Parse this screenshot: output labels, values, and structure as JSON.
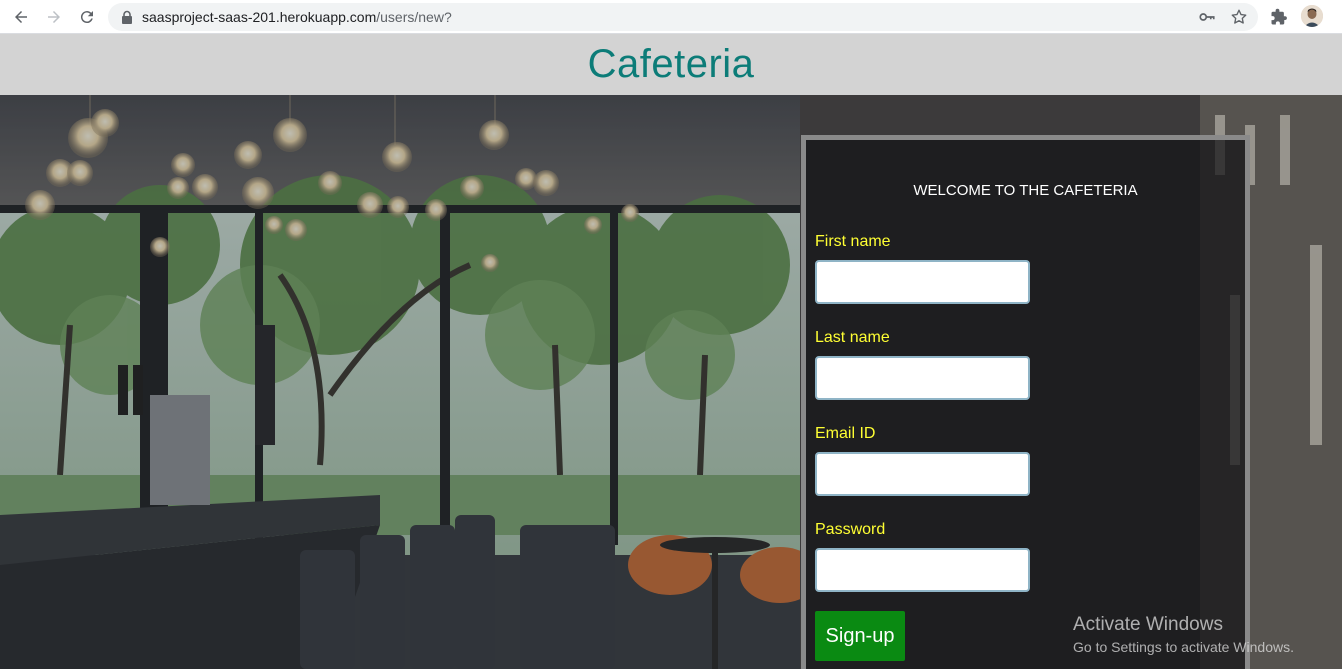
{
  "browser": {
    "url_host": "saasproject-saas-201.herokuapp.com",
    "url_path": "/users/new?",
    "icons": [
      "back-icon",
      "forward-icon",
      "reload-icon",
      "lock-icon",
      "key-icon",
      "star-icon",
      "puzzle-icon"
    ]
  },
  "header": {
    "title": "Cafeteria",
    "color": "#0c7c78"
  },
  "form": {
    "welcome": "WELCOME TO THE CAFETERIA",
    "fields": [
      {
        "label": "First name",
        "value": ""
      },
      {
        "label": "Last name",
        "value": ""
      },
      {
        "label": "Email ID",
        "value": ""
      },
      {
        "label": "Password",
        "value": ""
      }
    ],
    "submit_label": "Sign-up",
    "label_color": "#ffff33",
    "button_color": "#0a8a12"
  },
  "watermark": {
    "title": "Activate Windows",
    "subtitle": "Go to Settings to activate Windows."
  }
}
